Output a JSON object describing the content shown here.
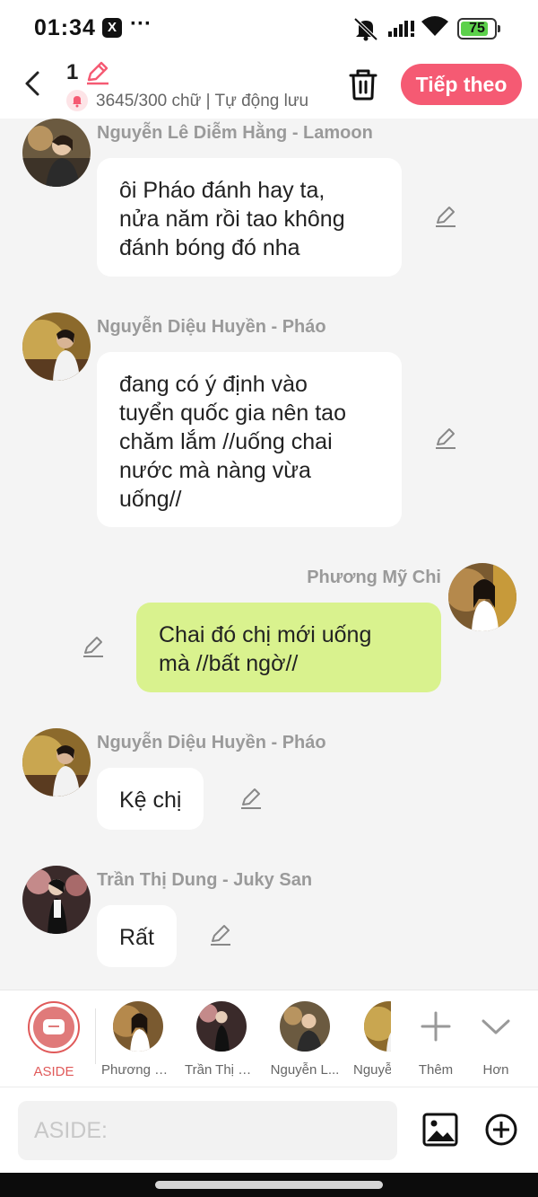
{
  "status_bar": {
    "time": "01:34",
    "app_badge": "X",
    "more": "···",
    "battery_level": "75",
    "battery_percent": 75
  },
  "header": {
    "title": "1",
    "word_count": "3645/300 chữ | Tự động lưu",
    "next_label": "Tiếp theo"
  },
  "messages": [
    {
      "sender": "Nguyễn Lê Diễm Hằng - Lamoon",
      "text": "ôi Pháo đánh hay ta,\nnửa năm rồi tao không\nđánh bóng đó nha",
      "mine": false
    },
    {
      "sender": "Nguyễn Diệu Huyền - Pháo",
      "text": "đang có ý định vào\ntuyển quốc gia nên tao\nchăm lắm //uống chai\nnước mà nàng vừa\nuống//",
      "mine": false
    },
    {
      "sender": "Phương Mỹ Chi",
      "text": "Chai đó chị mới uống\nmà //bất ngờ//",
      "mine": true
    },
    {
      "sender": "Nguyễn Diệu Huyền - Pháo",
      "text": "Kệ chị",
      "mine": false
    },
    {
      "sender": "Trần Thị Dung - Juky San",
      "text": "Rất",
      "mine": false
    }
  ],
  "characters": {
    "aside_label": "ASIDE",
    "items": [
      "Phương M...",
      "Trần Thị D...",
      "Nguyễn L...",
      "Nguyễ"
    ],
    "add_label": "Thêm",
    "more_label": "Hơn"
  },
  "input": {
    "placeholder": "ASIDE:"
  },
  "colors": {
    "accent": "#f55a73",
    "my_bubble": "#d9f28e",
    "other_bubble": "#ffffff",
    "background": "#f4f4f4"
  }
}
